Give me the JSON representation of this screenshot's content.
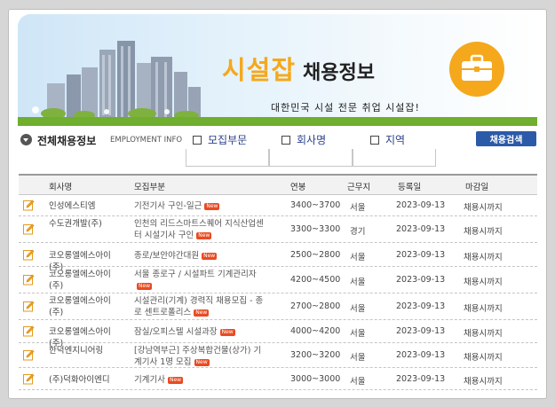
{
  "header": {
    "title_main": "시설잡",
    "title_sub": "채용정보",
    "slogan": "대한민국 시설 전문 취업 시설잡!",
    "icon": "briefcase-icon",
    "accent_color": "#f5a81c"
  },
  "search": {
    "section_title": "전체채용정보",
    "section_sub": "EMPLOYMENT INFO",
    "options": [
      "모집부문",
      "회사명",
      "지역"
    ],
    "search_button": "채용검색"
  },
  "table": {
    "columns": [
      "회사명",
      "모집부분",
      "연봉",
      "근무지",
      "등록일",
      "마감일"
    ],
    "new_badge": "New",
    "rows": [
      {
        "company": "인성에스티엠",
        "job": "기전기사 구인-일근",
        "new": true,
        "salary": "3400~3700",
        "location": "서울",
        "registered": "2023-09-13",
        "deadline": "채용시까지"
      },
      {
        "company": "수도권개발(주)",
        "job": "인천의 리드스마트스퀘어 지식산업센터 시설기사 구인",
        "new": true,
        "salary": "3300~3300",
        "location": "경기",
        "registered": "2023-09-13",
        "deadline": "채용시까지"
      },
      {
        "company": "코오롱엘에스아이(주)",
        "job": "종로/보안야간대원",
        "new": true,
        "salary": "2500~2800",
        "location": "서울",
        "registered": "2023-09-13",
        "deadline": "채용시까지"
      },
      {
        "company": "코오롱엘에스아이(주)",
        "job": "서울 종로구 / 시설파트 기계관리자",
        "new": true,
        "salary": "4200~4500",
        "location": "서울",
        "registered": "2023-09-13",
        "deadline": "채용시까지"
      },
      {
        "company": "코오롱엘에스아이(주)",
        "job": "시설관리(기계) 경력직 채용모집 - 종로 센트로폴리스",
        "new": true,
        "salary": "2700~2800",
        "location": "서울",
        "registered": "2023-09-13",
        "deadline": "채용시까지"
      },
      {
        "company": "코오롱엘에스아이(주)",
        "job": "잠실/오피스텔 시설과장",
        "new": true,
        "salary": "4000~4200",
        "location": "서울",
        "registered": "2023-09-13",
        "deadline": "채용시까지"
      },
      {
        "company": "한덕엔지니어링",
        "job": "[강남역부근] 주상복합건물(상가) 기계기사 1명 모집",
        "new": true,
        "salary": "3200~3200",
        "location": "서울",
        "registered": "2023-09-13",
        "deadline": "채용시까지"
      },
      {
        "company": "(주)덕화아이엔디",
        "job": "기계기사",
        "new": true,
        "salary": "3000~3000",
        "location": "서울",
        "registered": "2023-09-13",
        "deadline": "채용시까지"
      }
    ]
  }
}
